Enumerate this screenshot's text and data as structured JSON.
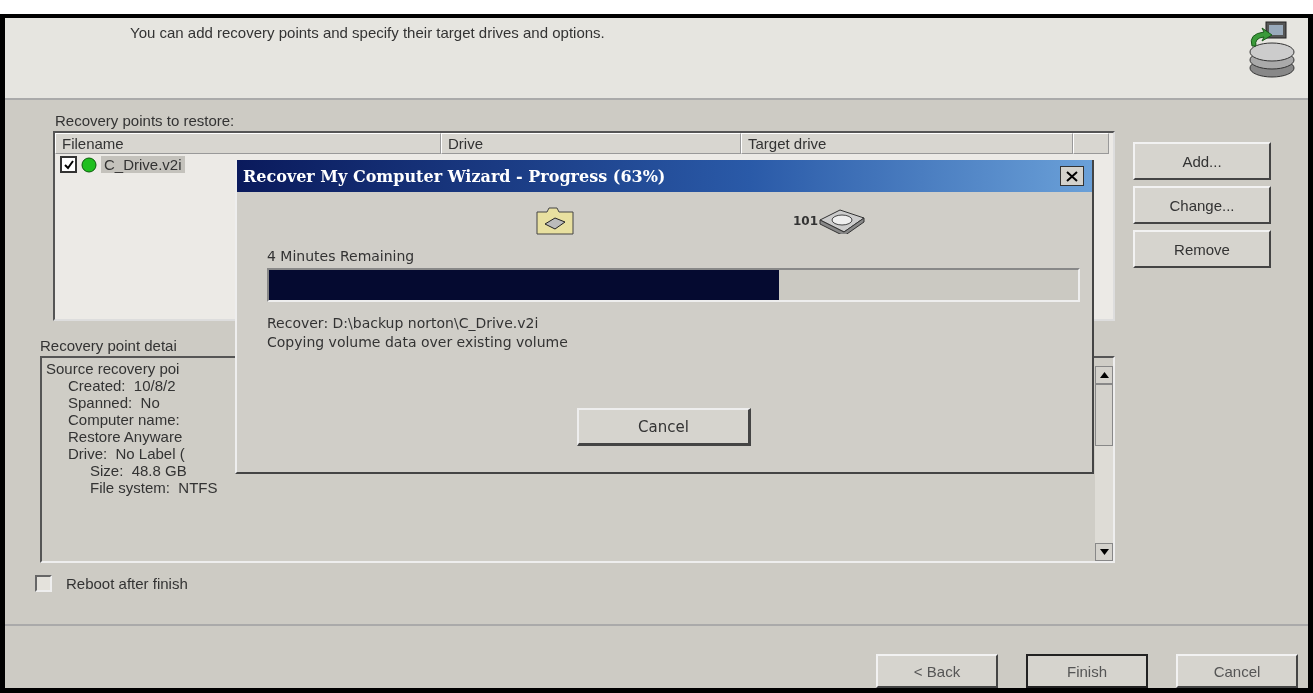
{
  "header": {
    "description": "You can add recovery points and specify their target drives and options."
  },
  "recovery_points": {
    "label": "Recovery points to restore:",
    "columns": [
      "Filename",
      "Drive",
      "Target drive"
    ],
    "rows": [
      {
        "filename": "C_Drive.v2i",
        "checked": true,
        "selected": true
      }
    ]
  },
  "side_buttons": [
    "Add...",
    "Change...",
    "Remove"
  ],
  "details": {
    "label": "Recovery point detai",
    "lines": [
      {
        "text": "Source recovery poi",
        "children": [
          {
            "text": "Created:  10/8/2"
          },
          {
            "text": "Spanned:  No"
          },
          {
            "text": "Computer name:"
          },
          {
            "text": "Restore Anyware"
          },
          {
            "text": "Drive:  No Label (",
            "children": [
              {
                "text": "Size:  48.8 GB"
              },
              {
                "text": "File system:  NTFS"
              }
            ]
          }
        ]
      }
    ]
  },
  "reboot": {
    "label": "Reboot after finish",
    "checked": false
  },
  "nav_buttons": [
    {
      "label": "< Back",
      "default": false
    },
    {
      "label": "Finish",
      "default": true
    },
    {
      "label": "Cancel",
      "default": false
    }
  ],
  "dialog": {
    "title": "Recover My Computer Wizard - Progress (63%)",
    "disk_label": "101",
    "remaining": "4 Minutes Remaining",
    "level": 0.63,
    "status_lines": [
      "Recover: D:\\backup norton\\C_Drive.v2i",
      "Copying volume data over existing volume"
    ],
    "button": "Cancel"
  }
}
